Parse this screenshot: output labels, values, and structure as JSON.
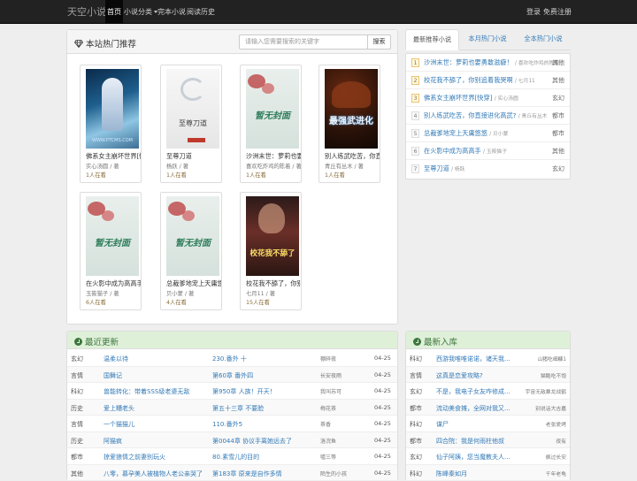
{
  "navbar": {
    "brand": "天空小说",
    "items": [
      "首页",
      "小说分类",
      "完本小说",
      "阅读历史"
    ],
    "login": "登录",
    "register": "免费注册"
  },
  "hot": {
    "title": "本站热门推荐",
    "search_placeholder": "请输入您需要搜索的关键字",
    "search_button": "搜索",
    "books": [
      {
        "title": "佛系女主崩坏世界[快",
        "author": "实心汤圆 / 著",
        "read": "1人在看",
        "cover_text": "WWW.PTCMS.COM"
      },
      {
        "title": "至尊刀道",
        "author": "杨跃 / 著",
        "read": "1人在看",
        "cover_text": "至尊刀道"
      },
      {
        "title": "沙洲末世：萝莉也要",
        "author": "喜欢吃炸鸡的陈着 / 著",
        "read": "1人在看",
        "cover_text": "暂无封面"
      },
      {
        "title": "别人练武吃苦，你直",
        "author": "青丘有丛木 / 著",
        "read": "1人在看",
        "cover_text": "最强武进化"
      },
      {
        "title": "在火影中成为高高手",
        "author": "玉筱猫子 / 著",
        "read": "6人在看",
        "cover_text": "暂无封面"
      },
      {
        "title": "总裁爹地宠上天庸悠悠",
        "author": "贝小蒙 / 著",
        "read": "4人在看",
        "cover_text": "暂无封面"
      },
      {
        "title": "校花我不舔了，你别",
        "author": "七月11 / 著",
        "read": "15人在看",
        "cover_text": "校花我不舔了"
      }
    ]
  },
  "rank": {
    "tabs": [
      "最新推荐小说",
      "本月热门小说",
      "全本热门小说"
    ],
    "items": [
      {
        "num": "1",
        "title": "沙洲末世：萝莉也要勇敢滋癖！",
        "author": "喜欢吃炸鸡的陈着",
        "cat": "其他"
      },
      {
        "num": "2",
        "title": "校花我不舔了，你别追着我哭啊",
        "author": "七月11",
        "cat": "其他"
      },
      {
        "num": "3",
        "title": "佛系女主崩坏世界[快穿]",
        "author": "实心汤圆",
        "cat": "玄幻"
      },
      {
        "num": "4",
        "title": "别人练武吃苦，你直接进化高武?",
        "author": "青丘有丛木",
        "cat": "都市"
      },
      {
        "num": "5",
        "title": "总裁爹地宠上天庸悠悠",
        "author": "贝小蒙",
        "cat": "都市"
      },
      {
        "num": "6",
        "title": "在火影中成为高高手",
        "author": "玉筱猫子",
        "cat": "其他"
      },
      {
        "num": "7",
        "title": "至尊刀道",
        "author": "杨跃",
        "cat": "玄幻"
      }
    ]
  },
  "updates": {
    "title": "最近更新",
    "rows": [
      {
        "cat": "玄幻",
        "book": "温柔以待",
        "chapter": "230.番外 十",
        "author": "棚碎夜",
        "date": "04-25"
      },
      {
        "cat": "言情",
        "book": "国舞记",
        "chapter": "第60章 番外四",
        "author": "长安夜雨",
        "date": "04-25"
      },
      {
        "cat": "科幻",
        "book": "兽能转化：带着SSS级老婆无敌",
        "chapter": "第950章 人族！开天！",
        "author": "我叫苏可",
        "date": "04-25"
      },
      {
        "cat": "历史",
        "book": "爱上糟老头",
        "chapter": "第五十三章 不要脸",
        "author": "梅花茶",
        "date": "04-25"
      },
      {
        "cat": "言情",
        "book": "一个猫猫儿",
        "chapter": "110.番外5",
        "author": "茶香",
        "date": "04-25"
      },
      {
        "cat": "历史",
        "book": "阿猫疯",
        "chapter": "第0044章 协议手离她远去了",
        "author": "洛浣鱼",
        "date": "04-25"
      },
      {
        "cat": "都市",
        "book": "掠爱狼情之前妻别玩火",
        "chapter": "80.素雪儿的目的",
        "author": "嘘三等",
        "date": "04-25"
      },
      {
        "cat": "其他",
        "book": "八零，慕孕美人被植物人老公亲哭了",
        "chapter": "第183章 原来是自作多情",
        "author": "陌生的小孩",
        "date": "04-25"
      }
    ]
  },
  "newbooks": {
    "title": "最新入库",
    "rows": [
      {
        "cat": "科幻",
        "book": "西游我唯唯诺诺，诸天我...",
        "author": "山猪吃细糠1"
      },
      {
        "cat": "言情",
        "book": "这真是恋爱攻略?",
        "author": "猫酷吃不饱"
      },
      {
        "cat": "玄幻",
        "book": "不是，我电子女友咋修成...",
        "author": "宇宙无敌暴龙战鹤"
      },
      {
        "cat": "都市",
        "book": "流动美食摊，全网对我又...",
        "author": "别说话大吉嘉"
      },
      {
        "cat": "科幻",
        "book": "谋尸",
        "author": "老张爱烤"
      },
      {
        "cat": "都市",
        "book": "四合院：我是何雨柱他叔",
        "author": "夜有"
      },
      {
        "cat": "玄幻",
        "book": "仙子阿姨，您当魔教夫人...",
        "author": "枫过长安"
      },
      {
        "cat": "科幻",
        "book": "陈峰秦如月",
        "author": "千年老龟"
      }
    ]
  },
  "colors": {
    "link": "#337ab7",
    "green": "#3c763d",
    "green_bg": "#dff0d8"
  }
}
